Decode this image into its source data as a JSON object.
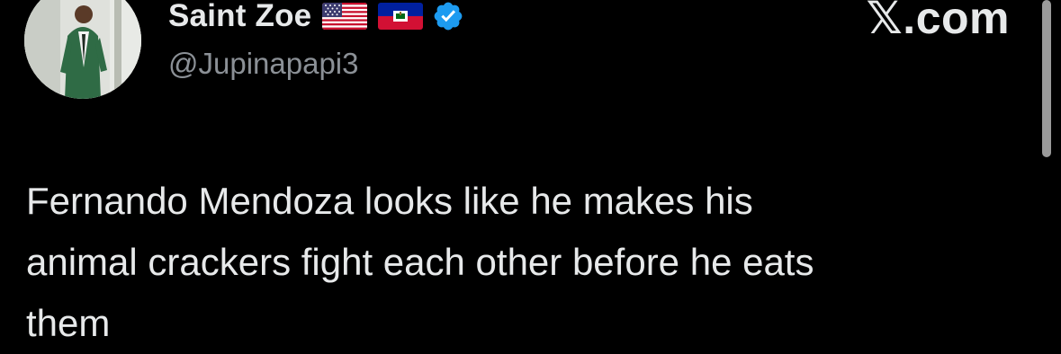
{
  "tweet": {
    "author": {
      "display_name": "Saint Zoe",
      "handle": "@Jupinapapi3",
      "avatar": "profile-photo",
      "flags": [
        "us-flag-icon",
        "haiti-flag-icon"
      ],
      "verified_icon": "verified-badge-icon",
      "verified_color": "#1d9bf0"
    },
    "brand": "𝕏.com",
    "text": "Fernando Mendoza looks like he makes his\nanimal crackers fight each other before he eats\nthem"
  },
  "colors": {
    "background": "#000000",
    "text": "#e7e9ea",
    "muted": "#8b9096",
    "scrollbar": "#9a9a9a"
  }
}
